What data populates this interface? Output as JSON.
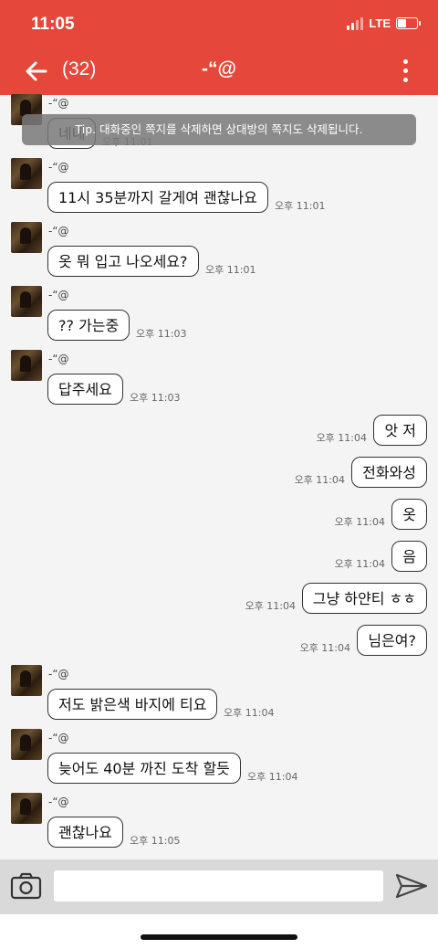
{
  "status_bar": {
    "time": "11:05",
    "network": "LTE",
    "battery_level": 0.45
  },
  "header": {
    "unread_count": "(32)",
    "title": "-“@"
  },
  "tip": {
    "text": "Tip. 대화중인 쪽지를 삭제하면 상대방의 쪽지도 삭제됩니다."
  },
  "messages": [
    {
      "side": "left",
      "sender": "-“@",
      "text": "네네",
      "time": "오후 11:01"
    },
    {
      "side": "left",
      "sender": "-“@",
      "text": "11시 35분까지 갈게여 괜찮나요",
      "time": "오후 11:01"
    },
    {
      "side": "left",
      "sender": "-“@",
      "text": "옷 뭐 입고 나오세요?",
      "time": "오후 11:01"
    },
    {
      "side": "left",
      "sender": "-“@",
      "text": "?? 가는중",
      "time": "오후 11:03"
    },
    {
      "side": "left",
      "sender": "-“@",
      "text": "답주세요",
      "time": "오후 11:03"
    },
    {
      "side": "right",
      "text": "앗 저",
      "time": "오후 11:04"
    },
    {
      "side": "right",
      "text": "전화와성",
      "time": "오후 11:04"
    },
    {
      "side": "right",
      "text": "옷",
      "time": "오후 11:04"
    },
    {
      "side": "right",
      "text": "음",
      "time": "오후 11:04"
    },
    {
      "side": "right",
      "text": "그냥 하얀티 ㅎㅎ",
      "time": "오후 11:04"
    },
    {
      "side": "right",
      "text": "님은여?",
      "time": "오후 11:04"
    },
    {
      "side": "left",
      "sender": "-“@",
      "text": "저도 밝은색 바지에 티요",
      "time": "오후 11:04"
    },
    {
      "side": "left",
      "sender": "-“@",
      "text": "늦어도 40분 까진 도착 할듯",
      "time": "오후 11:04"
    },
    {
      "side": "left",
      "sender": "-“@",
      "text": "괜찮나요",
      "time": "오후 11:05"
    }
  ],
  "composer": {
    "placeholder": "",
    "value": ""
  },
  "icons": {
    "back": "back-arrow-icon",
    "more": "more-vertical-icon",
    "camera": "camera-icon",
    "send": "send-icon"
  },
  "colors": {
    "accent": "#e5483a",
    "bubble_bg": "#ffffff",
    "chat_bg": "#f4f4f4"
  }
}
